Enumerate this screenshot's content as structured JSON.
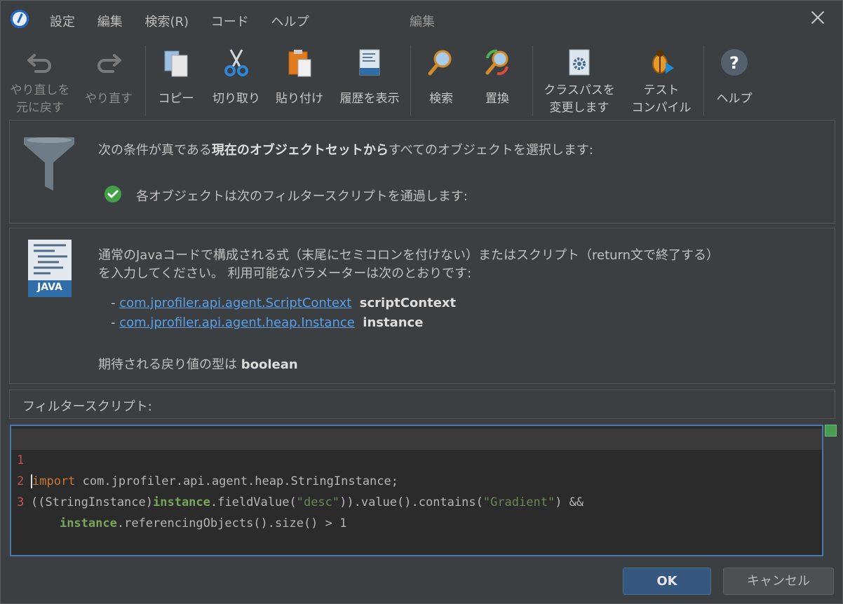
{
  "menu": [
    "設定",
    "編集",
    "検索(R)",
    "コード",
    "ヘルプ"
  ],
  "window_title": "編集",
  "toolbar": {
    "undo": "やり直しを\n元に戻す",
    "redo": "やり直す",
    "copy": "コピー",
    "cut": "切り取り",
    "paste": "貼り付け",
    "history": "履歴を表示",
    "find": "検索",
    "replace": "置換",
    "classpath": "クラスパスを\n変更します",
    "test_compile": "テスト\nコンパイル",
    "help": "ヘルプ"
  },
  "filter_panel": {
    "sentence_pre": "次の条件が真である",
    "sentence_bold": "現在のオブジェクトセットから",
    "sentence_post": "すべてのオブジェクトを選択します:",
    "condition": "各オブジェクトは次のフィルタースクリプトを通過します:"
  },
  "java_panel": {
    "badge": "JAVA",
    "line1": "通常のJavaコードで構成される式（末尾にセミコロンを付けない）またはスクリプト（return文で終了する）",
    "line2": "を入力してください。 利用可能なパラメーターは次のとおりです:",
    "params": [
      {
        "type": "com.jprofiler.api.agent.ScriptContext",
        "name": "scriptContext"
      },
      {
        "type": "com.jprofiler.api.agent.heap.Instance",
        "name": "instance"
      }
    ],
    "return_pre": "期待される戻り値の型は",
    "return_type": "boolean"
  },
  "script_label": "フィルタースクリプト:",
  "code": {
    "line_numbers": [
      "1",
      "2",
      "3"
    ],
    "l1_kw": "import",
    "l1_rest": " com.jprofiler.api.agent.heap.StringInstance;",
    "l2_a": "((StringInstance)",
    "l2_var": "instance",
    "l2_b": ".fieldValue(",
    "l2_str1": "\"desc\"",
    "l2_c": ")).value().contains(",
    "l2_str2": "\"Gradient\"",
    "l2_d": ") &&",
    "l3_indent": "    ",
    "l3_var": "instance",
    "l3_rest": ".referencingObjects().size() > 1"
  },
  "buttons": {
    "ok": "OK",
    "cancel": "キャンセル"
  },
  "colors": {
    "accent": "#365880",
    "link": "#5a9fe8",
    "keyword": "#cc7832",
    "string": "#6a8759"
  }
}
